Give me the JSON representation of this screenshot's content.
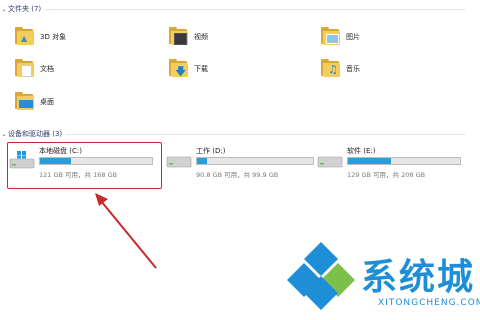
{
  "sections": {
    "folders": {
      "title": "文件夹 (7)"
    },
    "devices": {
      "title": "设备和驱动器 (3)"
    }
  },
  "folders": [
    {
      "label": "3D 对象",
      "icon": "3d-objects-folder-icon"
    },
    {
      "label": "视频",
      "icon": "videos-folder-icon"
    },
    {
      "label": "图片",
      "icon": "pictures-folder-icon"
    },
    {
      "label": "文档",
      "icon": "documents-folder-icon"
    },
    {
      "label": "下载",
      "icon": "downloads-folder-icon"
    },
    {
      "label": "音乐",
      "icon": "music-folder-icon"
    },
    {
      "label": "桌面",
      "icon": "desktop-folder-icon"
    }
  ],
  "drives": [
    {
      "name": "本地磁盘 (C:)",
      "free_text": "121 GB 可用，共 168 GB",
      "used_fraction": 0.28,
      "icon": "windows-drive-icon"
    },
    {
      "name": "工作 (D:)",
      "free_text": "90.8 GB 可用，共 99.9 GB",
      "used_fraction": 0.09,
      "icon": "hard-drive-icon"
    },
    {
      "name": "软件 (E:)",
      "free_text": "129 GB 可用，共 208 GB",
      "used_fraction": 0.38,
      "icon": "hard-drive-icon"
    }
  ],
  "watermark": {
    "brand": "系统城",
    "url": "XITONGCHENG.COM"
  },
  "colors": {
    "usage_bar": "#26a0da",
    "highlight": "#c62a2a",
    "arrow": "#c62a2a",
    "watermark": "#1e8fd6"
  }
}
